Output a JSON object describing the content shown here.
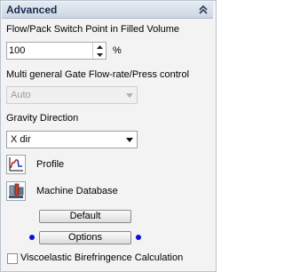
{
  "panel": {
    "title": "Advanced",
    "collapse_icon": "chevron-double-up-icon"
  },
  "flow_pack": {
    "label": "Flow/Pack Switch Point in Filled Volume",
    "value": "100",
    "unit": "%"
  },
  "gate_control": {
    "label": "Multi general Gate Flow-rate/Press control",
    "selected": "Auto",
    "enabled": false
  },
  "gravity": {
    "label": "Gravity Direction",
    "selected": "X dir"
  },
  "profile": {
    "label": "Profile",
    "icon": "profile-chart-icon"
  },
  "machine_db": {
    "label": "Machine Database",
    "icon": "machine-database-icon"
  },
  "buttons": {
    "default_label": "Default",
    "options_label": "Options"
  },
  "viscoelastic": {
    "label": "Viscoelastic Birefringence Calculation",
    "checked": false
  },
  "colors": {
    "accent_dot": "#0a10d8",
    "header_text": "#1a2a4a"
  }
}
